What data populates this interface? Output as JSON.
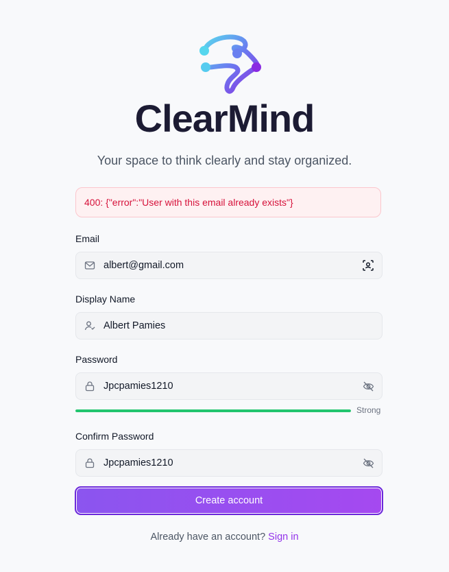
{
  "brand": {
    "name": "ClearMind",
    "tagline": "Your space to think clearly and stay organized."
  },
  "error": {
    "message": "400: {\"error\":\"User with this email already exists\"}"
  },
  "form": {
    "email": {
      "label": "Email",
      "value": "albert@gmail.com",
      "lead_icon": "mail-icon",
      "trail_icon": "contact-autofill-icon"
    },
    "display_name": {
      "label": "Display Name",
      "value": "Albert Pamies",
      "lead_icon": "user-check-icon"
    },
    "password": {
      "label": "Password",
      "value": "Jpcpamies1210",
      "lead_icon": "lock-icon",
      "trail_icon": "eye-off-icon",
      "strength_label": "Strong",
      "strength_fraction": 1.0
    },
    "confirm_password": {
      "label": "Confirm Password",
      "value": "Jpcpamies1210",
      "lead_icon": "lock-icon",
      "trail_icon": "eye-off-icon"
    },
    "submit_label": "Create account"
  },
  "footer": {
    "prompt": "Already have an account?",
    "link": "Sign in"
  },
  "colors": {
    "accent": "#9333ea",
    "error": "#d6113a",
    "strength": "#22c56e"
  }
}
